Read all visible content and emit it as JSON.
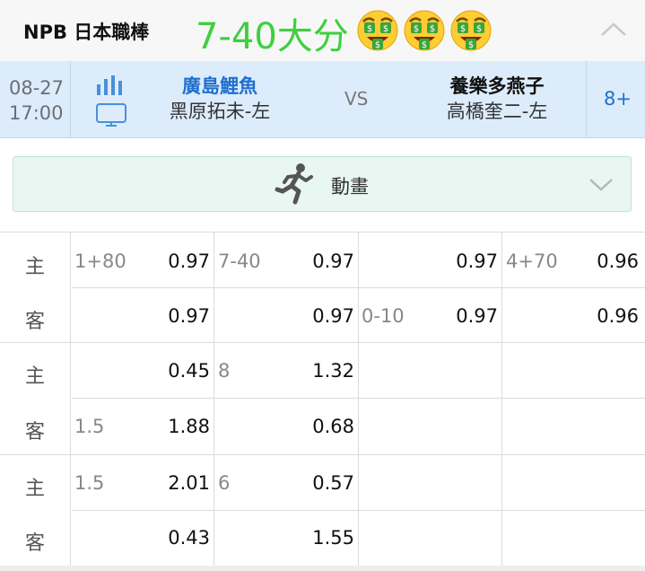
{
  "header": {
    "league": "NPB 日本職棒",
    "tag": "7-40大分",
    "emoji_icon": "money-mouth-face-icon",
    "tag_color": "#3fcf3f"
  },
  "match": {
    "date": "08-27",
    "time": "17:00",
    "home_team": "廣島鯉魚",
    "home_pitcher": "黑原拓未-左",
    "vs": "VS",
    "away_team": "養樂多燕子",
    "away_pitcher": "高橋奎二-左",
    "more": "8+",
    "home_color": "#1f6fd0"
  },
  "animation": {
    "label": "動畫"
  },
  "odds": {
    "groups": [
      {
        "rows": [
          {
            "side": "主",
            "c1_line": "1+80",
            "c1_odd": "0.97",
            "c2_line": "7-40",
            "c2_odd": "0.97",
            "c3_line": "",
            "c3_odd": "0.97",
            "c4_line": "4+70",
            "c4_odd": "0.96"
          },
          {
            "side": "客",
            "c1_line": "",
            "c1_odd": "0.97",
            "c2_line": "",
            "c2_odd": "0.97",
            "c3_line": "0-10",
            "c3_odd": "0.97",
            "c4_line": "",
            "c4_odd": "0.96"
          }
        ]
      },
      {
        "rows": [
          {
            "side": "主",
            "c1_line": "",
            "c1_odd": "0.45",
            "c2_line": "8",
            "c2_odd": "1.32"
          },
          {
            "side": "客",
            "c1_line": "1.5",
            "c1_odd": "1.88",
            "c2_line": "",
            "c2_odd": "0.68"
          }
        ]
      },
      {
        "rows": [
          {
            "side": "主",
            "c1_line": "1.5",
            "c1_odd": "2.01",
            "c2_line": "6",
            "c2_odd": "0.57"
          },
          {
            "side": "客",
            "c1_line": "",
            "c1_odd": "0.43",
            "c2_line": "",
            "c2_odd": "1.55"
          }
        ]
      }
    ]
  }
}
